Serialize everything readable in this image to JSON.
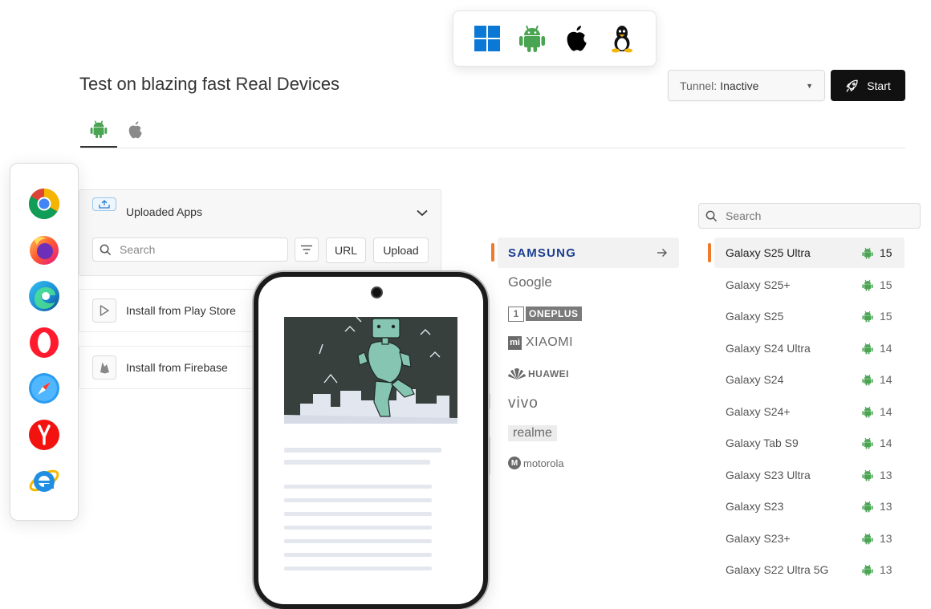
{
  "os_switcher": [
    {
      "name": "windows-icon",
      "color": "#0a78d4"
    },
    {
      "name": "android-icon",
      "color": "#4aa553"
    },
    {
      "name": "apple-icon",
      "color": "#000000"
    },
    {
      "name": "linux-icon",
      "color": "#000000"
    }
  ],
  "header": {
    "title": "Test on blazing fast Real Devices",
    "tunnel_label": "Tunnel:",
    "tunnel_value": "Inactive",
    "start_label": "Start"
  },
  "os_tabs": [
    {
      "icon": "android-icon",
      "active": true
    },
    {
      "icon": "apple-icon",
      "active": false
    }
  ],
  "browsers": [
    "chrome-icon",
    "firefox-icon",
    "edge-icon",
    "opera-icon",
    "safari-icon",
    "yandex-icon",
    "internet-explorer-icon"
  ],
  "apps_panel": {
    "title": "Uploaded Apps",
    "search_placeholder": "Search",
    "url_label": "URL",
    "upload_label": "Upload",
    "install_play": "Install from Play Store",
    "install_firebase": "Install from Firebase"
  },
  "brands": [
    {
      "label": "SAMSUNG",
      "active": true
    },
    {
      "label": "Google",
      "active": false
    },
    {
      "label": "ONEPLUS",
      "active": false
    },
    {
      "label": "XIAOMI",
      "active": false
    },
    {
      "label": "HUAWEI",
      "active": false
    },
    {
      "label": "vivo",
      "active": false
    },
    {
      "label": "realme",
      "active": false
    },
    {
      "label": "motorola",
      "active": false
    }
  ],
  "devices": {
    "search_placeholder": "Search",
    "items": [
      {
        "name": "Galaxy S25 Ultra",
        "version": "15",
        "active": true
      },
      {
        "name": "Galaxy S25+",
        "version": "15"
      },
      {
        "name": "Galaxy S25",
        "version": "15"
      },
      {
        "name": "Galaxy S24 Ultra",
        "version": "14"
      },
      {
        "name": "Galaxy S24",
        "version": "14"
      },
      {
        "name": "Galaxy S24+",
        "version": "14"
      },
      {
        "name": "Galaxy Tab S9",
        "version": "14"
      },
      {
        "name": "Galaxy S23 Ultra",
        "version": "13"
      },
      {
        "name": "Galaxy S23",
        "version": "13"
      },
      {
        "name": "Galaxy S23+",
        "version": "13"
      },
      {
        "name": "Galaxy S22 Ultra 5G",
        "version": "13"
      }
    ]
  },
  "colors": {
    "accent": "#f07a2c",
    "android": "#4aa553",
    "dark": "#111111"
  }
}
